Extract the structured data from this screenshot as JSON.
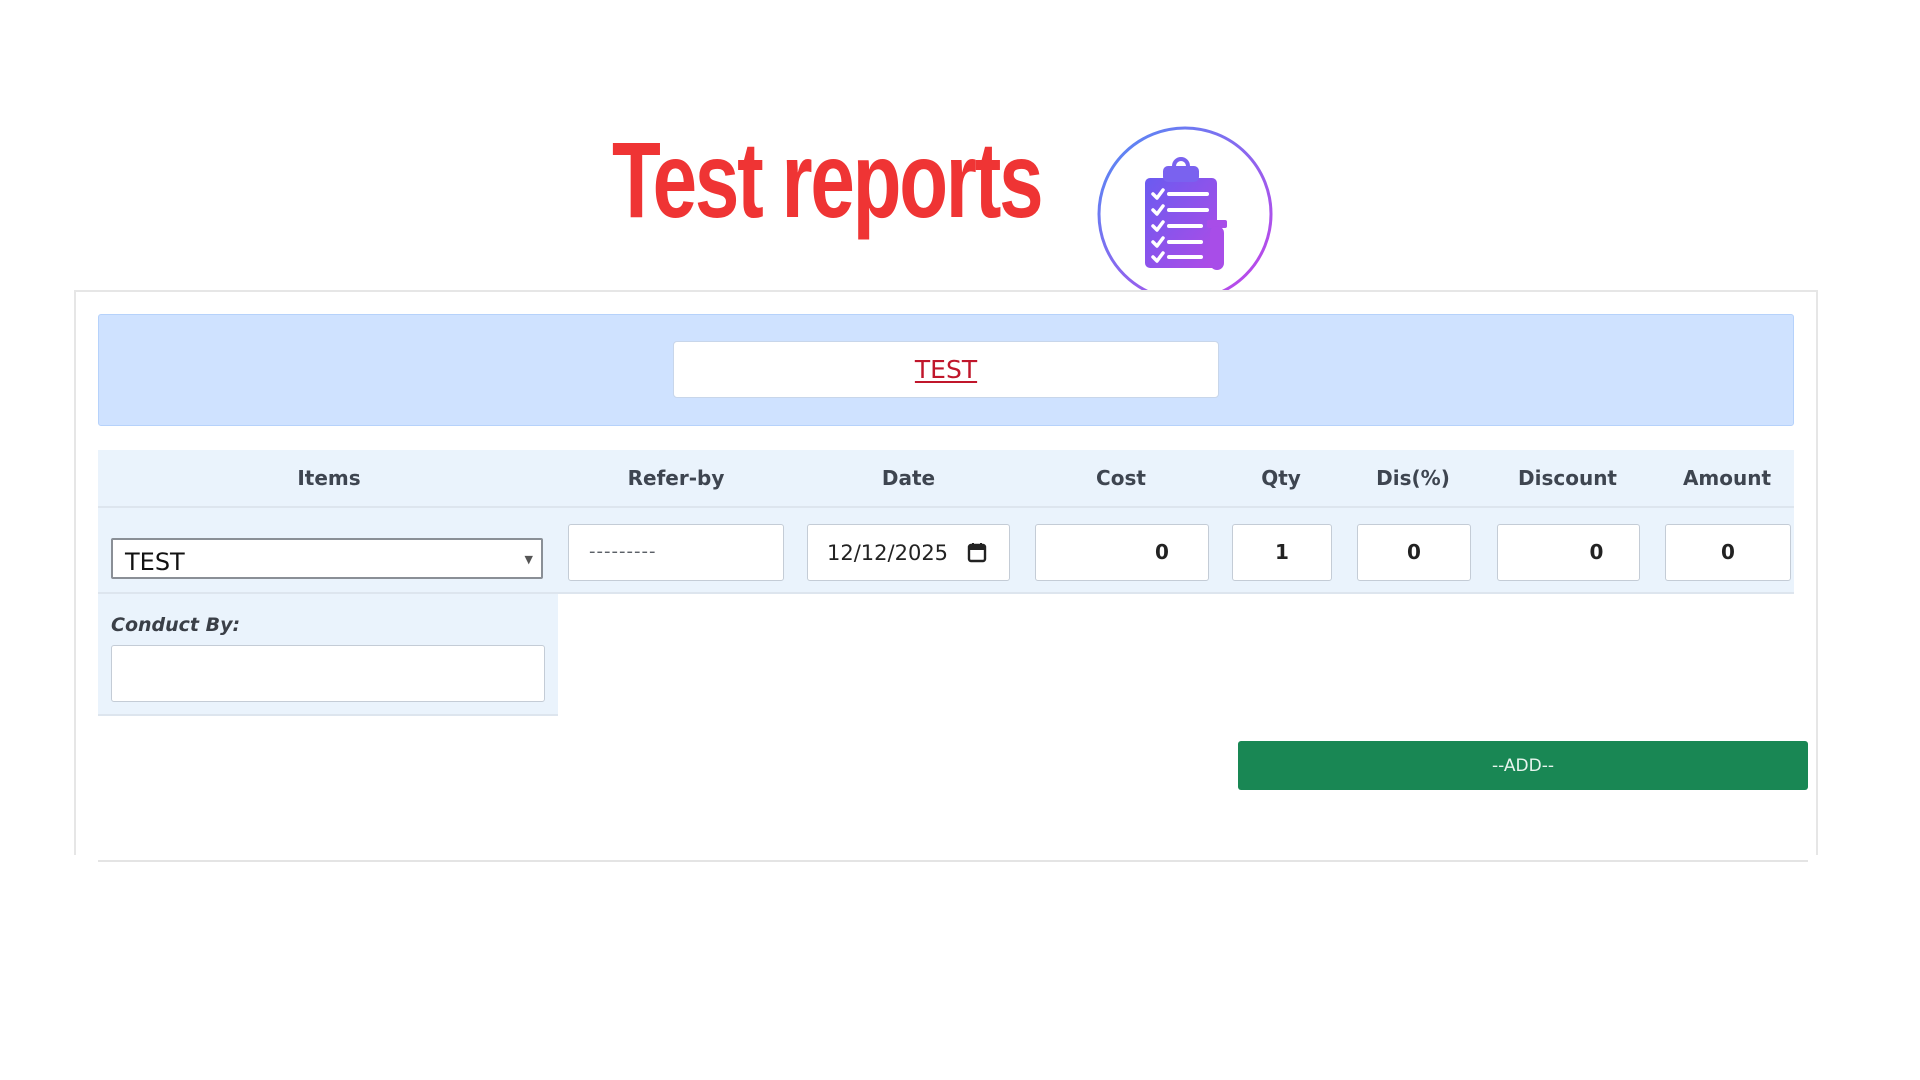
{
  "promo": {
    "title": "Test reports",
    "icon": "clipboard-checklist-icon",
    "title_color": "#ef3434"
  },
  "header": {
    "test_name": "TEST"
  },
  "table": {
    "columns": [
      "Items",
      "Refer-by",
      "Date",
      "Cost",
      "Qty",
      "Dis(%)",
      "Discount",
      "Amount"
    ],
    "row": {
      "item": "TEST",
      "refer_by_placeholder": "---------",
      "date": "12/12/2025",
      "cost": "0",
      "qty": "1",
      "dis_percent": "0",
      "discount": "0",
      "amount": "0"
    }
  },
  "conduct": {
    "label": "Conduct By:",
    "value": ""
  },
  "actions": {
    "add_label": "--ADD--"
  },
  "colors": {
    "header_band": "#cfe2ff",
    "table_bg": "#eaf3fc",
    "add_button": "#198754",
    "test_link": "#c0162b"
  }
}
